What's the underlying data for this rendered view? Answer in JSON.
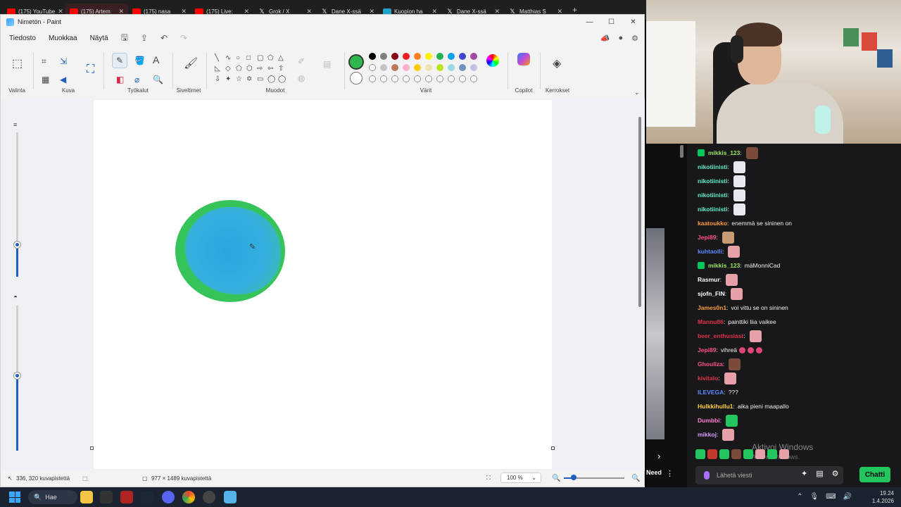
{
  "browser": {
    "tabs": [
      {
        "label": "(175) YouTube",
        "icon": "youtube-icon",
        "active": false
      },
      {
        "label": "(175) Artem",
        "icon": "youtube-icon",
        "active": true
      },
      {
        "label": "(175) nasa",
        "icon": "youtube-icon",
        "active": false
      },
      {
        "label": "(175) Live:",
        "icon": "youtube-icon",
        "active": false
      },
      {
        "label": "Grok / X",
        "icon": "x-icon",
        "active": false
      },
      {
        "label": "Dane X-ssä",
        "icon": "x-icon",
        "active": false
      },
      {
        "label": "Kuopion ha",
        "icon": "kuopio-icon",
        "active": false
      },
      {
        "label": "Dane X-ssä",
        "icon": "x-icon",
        "active": false
      },
      {
        "label": "Matthias S",
        "icon": "x-icon",
        "active": false
      }
    ],
    "new_tab": "+"
  },
  "paint": {
    "title": "Nimetön - Paint",
    "menu": [
      "Tiedosto",
      "Muokkaa",
      "Näytä"
    ],
    "groups": {
      "valinta": "Valinta",
      "kuva": "Kuva",
      "tyokalut": "Työkalut",
      "siveltimet": "Siveltimet",
      "muodot": "Muodot",
      "varit": "Värit",
      "copilot": "Copilot",
      "kerrokset": "Kerrokset"
    },
    "active_color": "#2db84d",
    "palette_row1": [
      "#000000",
      "#7f7f7f",
      "#880015",
      "#ed1c24",
      "#ff7f27",
      "#fff200",
      "#22b14c",
      "#00a2e8",
      "#3f48cc",
      "#a349a4"
    ],
    "palette_row2": [
      "#ffffff",
      "#c3c3c3",
      "#b97a57",
      "#ffaec9",
      "#ffc90e",
      "#efe4b0",
      "#b5e61d",
      "#99d9ea",
      "#7092be",
      "#c8bfe7"
    ],
    "status": {
      "cursor": "336, 320 kuvapistettä",
      "size": "977 × 1489 kuvapistettä",
      "zoom": "100 %"
    }
  },
  "taskbar": {
    "search": "Hae",
    "time": "19.24",
    "date": "1.4.2026"
  },
  "chat": {
    "messages": [
      {
        "user": "mikkis_123",
        "color": "#9ae65c",
        "text": "",
        "badge": true,
        "emote": "#7a4a3a"
      },
      {
        "user": "nikotiinisti",
        "color": "#5ef0c8",
        "text": "",
        "emote": "#e8e8f0"
      },
      {
        "user": "nikotiinisti",
        "color": "#5ef0c8",
        "text": "",
        "emote": "#e8e8f0"
      },
      {
        "user": "nikotiinisti",
        "color": "#5ef0c8",
        "text": "",
        "emote": "#e8e8f0"
      },
      {
        "user": "nikotiinisti",
        "color": "#5ef0c8",
        "text": "",
        "emote": "#e8e8f0"
      },
      {
        "user": "kaatoukko",
        "color": "#ff9a3c",
        "text": "enemmä se sininen on"
      },
      {
        "user": "Jepi89",
        "color": "#ff4f8b",
        "text": "",
        "emote": "#c89b74"
      },
      {
        "user": "kuhtaolli",
        "color": "#5b8bff",
        "text": "",
        "emote": "#e8a0a8"
      },
      {
        "user": "mikkis_123",
        "color": "#9ae65c",
        "text": "mäMonniCad",
        "badge": true
      },
      {
        "user": "Rasmur",
        "color": "#ffffff",
        "text": "",
        "emote": "#e8a0a8"
      },
      {
        "user": "sjofn_FIN",
        "color": "#ffffff",
        "text": "",
        "emote": "#e8a0a8"
      },
      {
        "user": "James0n1",
        "color": "#ff9a3c",
        "text": "voi vittu se on sininen"
      },
      {
        "user": "Mannu86",
        "color": "#e0304a",
        "text": "painttiki liia vaikee"
      },
      {
        "user": "beer_enthusiast",
        "color": "#e0304a",
        "text": "",
        "emote": "#e8a0a8"
      },
      {
        "user": "Jepi89",
        "color": "#ff4f8b",
        "text": "vihreä",
        "emoji": true
      },
      {
        "user": "Ghouliza",
        "color": "#ff4f8b",
        "text": "",
        "emote": "#7a4a3a"
      },
      {
        "user": "kivitalo",
        "color": "#e0304a",
        "text": "",
        "emote": "#e8a0a8"
      },
      {
        "user": "ILEVEGA",
        "color": "#5b8bff",
        "text": "???"
      },
      {
        "user": "Hulkkihullu1",
        "color": "#ffd23c",
        "text": "aika pieni maapallo"
      },
      {
        "user": "Dumbbi",
        "color": "#ff7ad0",
        "text": "",
        "emote": "#22c55e"
      },
      {
        "user": "mikkoj",
        "color": "#d59bff",
        "text": "",
        "emote": "#e8a0a8"
      }
    ],
    "watermark": "Aktivoi Windows",
    "watermark_sub": "Aktivoi Windows.",
    "input_placeholder": "Lähetä viesti",
    "send_label": "Chatti",
    "need_label": "Need"
  }
}
